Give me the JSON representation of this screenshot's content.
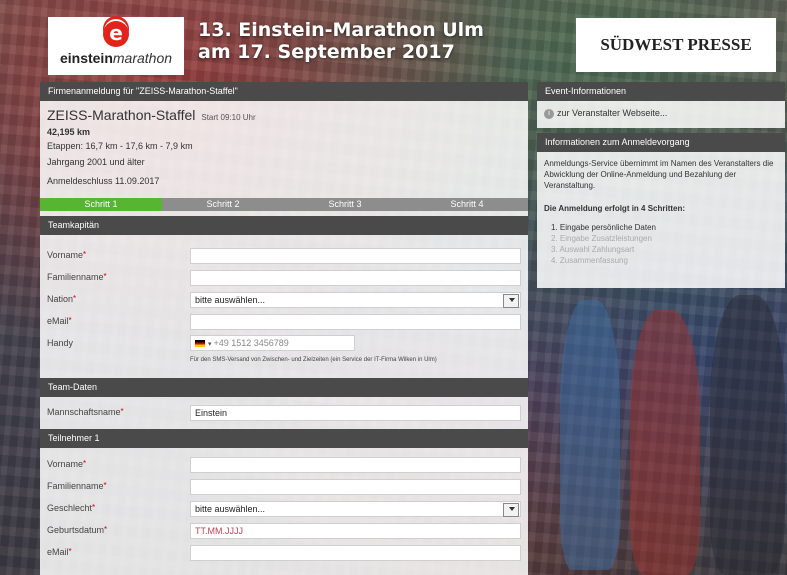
{
  "header": {
    "logo_letter": "e",
    "logo_word_bold": "einstein",
    "logo_word_italic": "marathon",
    "title_line1": "13. Einstein-Marathon Ulm",
    "title_line2": "am 17. September 2017",
    "sponsor": "SÜDWEST PRESSE"
  },
  "registration": {
    "bar_title": "Firmenanmeldung für \"ZEISS-Marathon-Staffel\"",
    "event_name": "ZEISS-Marathon-Staffel",
    "start": "Start 09:10 Uhr",
    "distance": "42,195 km",
    "stages": "Etappen: 16,7 km - 17,6 km - 7,9 km",
    "age": "Jahrgang 2001 und älter",
    "deadline": "Anmeldeschluss 11.09.2017"
  },
  "steps": [
    "Schritt 1",
    "Schritt 2",
    "Schritt 3",
    "Schritt 4"
  ],
  "active_step": 0,
  "team_captain": {
    "title": "Teamkapitän",
    "firstname_label": "Vorname",
    "lastname_label": "Familienname",
    "nation_label": "Nation",
    "nation_value": "bitte auswählen...",
    "email_label": "eMail",
    "phone_label": "Handy",
    "phone_placeholder": "+49 1512 3456789",
    "phone_note": "Für den SMS-Versand von Zwischen- und Zielzeiten (ein Service der IT-Firma Wilken in Ulm)"
  },
  "team_data": {
    "title": "Team-Daten",
    "team_name_label": "Mannschaftsname",
    "team_name_value": "Einstein"
  },
  "participant": {
    "title": "Teilnehmer 1",
    "firstname_label": "Vorname",
    "lastname_label": "Familienname",
    "gender_label": "Geschlecht",
    "gender_value": "bitte auswählen...",
    "birthdate_label": "Geburtsdatum",
    "birthdate_placeholder": "TT.MM.JJJJ",
    "email_label": "eMail"
  },
  "event_info": {
    "title": "Event-Informationen",
    "link": "zur Veranstalter Webseite..."
  },
  "reg_info": {
    "title": "Informationen zum Anmeldevorgang",
    "text": "Anmeldungs-Service übernimmt im Namen des Veranstalters die Abwicklung der Online-Anmeldung und Bezahlung der Veranstaltung.",
    "bold": "Die Anmeldung erfolgt in 4 Schritten:",
    "steps": [
      "1. Eingabe persönliche Daten",
      "2. Eingabe Zusatzleistungen",
      "3. Auswahl Zahlungsart",
      "4. Zusammenfassung"
    ]
  },
  "colors": {
    "active_step": "#57b532",
    "inactive_step": "#8d8d8d",
    "bar": "#4a4a4a",
    "required": "#cc0000"
  }
}
